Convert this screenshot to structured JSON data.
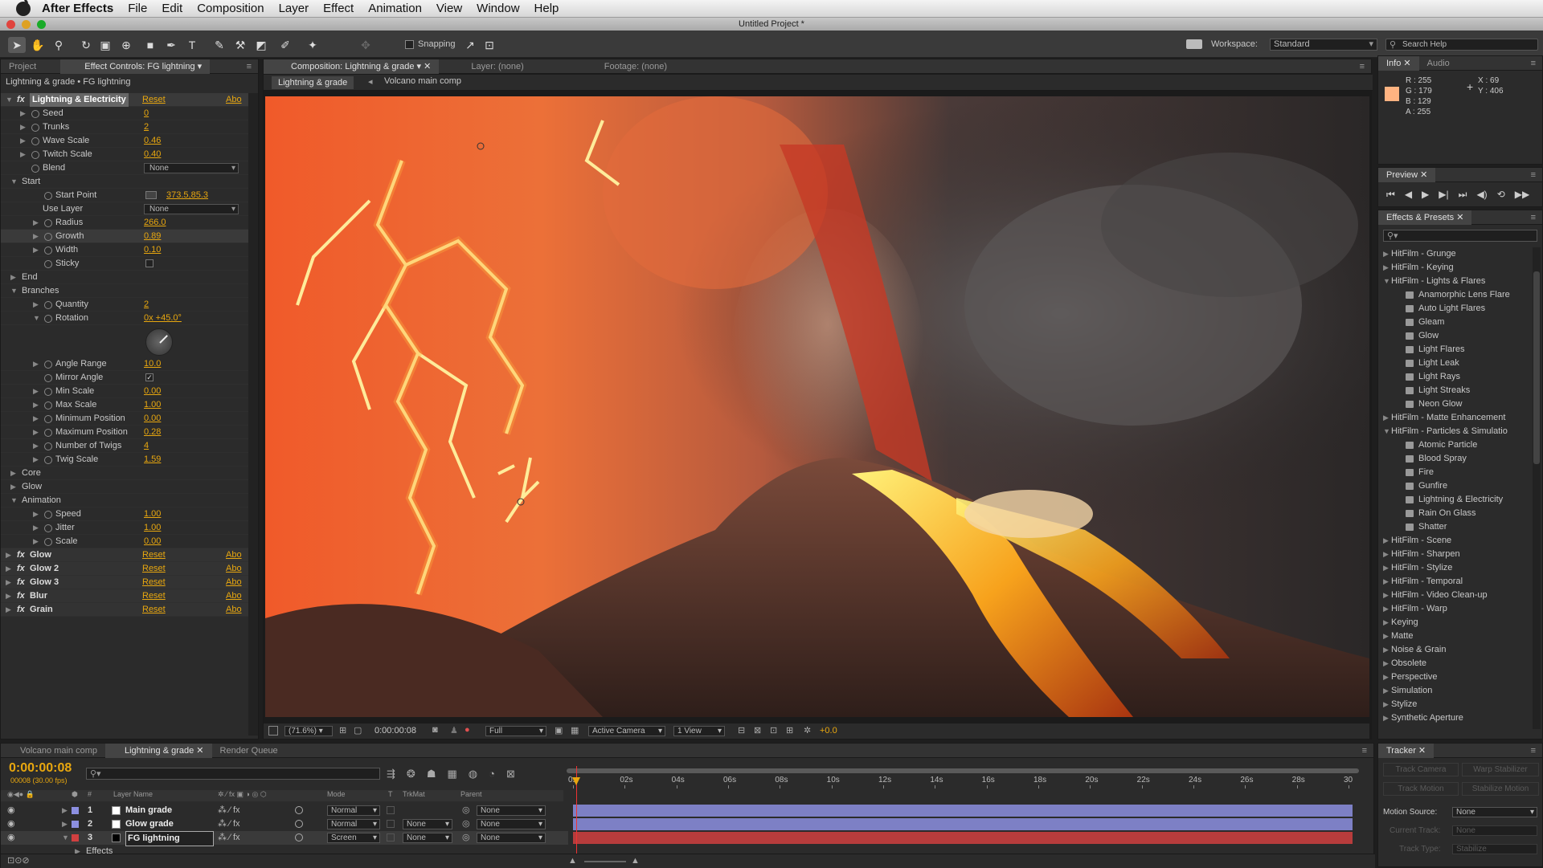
{
  "menubar": {
    "app": "After Effects",
    "items": [
      "File",
      "Edit",
      "Composition",
      "Layer",
      "Effect",
      "Animation",
      "View",
      "Window",
      "Help"
    ]
  },
  "window": {
    "title": "Untitled Project *"
  },
  "toolbar": {
    "snapping": "Snapping",
    "workspace_label": "Workspace:",
    "workspace_value": "Standard",
    "search_placeholder": "Search Help"
  },
  "left_panel": {
    "tab_project": "Project",
    "tab_effect": "Effect Controls: FG lightning",
    "breadcrumb": "Lightning & grade • FG lightning",
    "main_effect": {
      "name": "Lightning & Electricity",
      "reset": "Reset",
      "about": "Abo"
    },
    "props": [
      {
        "label": "Seed",
        "value": "0",
        "indent": 1,
        "tri": "right"
      },
      {
        "label": "Trunks",
        "value": "2",
        "indent": 1,
        "tri": "right"
      },
      {
        "label": "Wave Scale",
        "value": "0.46",
        "indent": 1,
        "tri": "right"
      },
      {
        "label": "Twitch Scale",
        "value": "0.40",
        "indent": 1,
        "tri": "right"
      },
      {
        "label": "Blend",
        "dropdown": "None",
        "indent": 1,
        "tri": "none"
      },
      {
        "label": "Start",
        "indent": 0,
        "tri": "down",
        "group": true
      },
      {
        "label": "Start Point",
        "value": "373.5,85.3",
        "indent": 2,
        "tri": "none",
        "point": true
      },
      {
        "label": "Use Layer",
        "dropdown": "None",
        "indent": 2,
        "tri": "none",
        "nosw": true
      },
      {
        "label": "Radius",
        "value": "266.0",
        "indent": 2,
        "tri": "right"
      },
      {
        "label": "Growth",
        "value": "0.89",
        "indent": 2,
        "tri": "right",
        "hl": true
      },
      {
        "label": "Width",
        "value": "0.10",
        "indent": 2,
        "tri": "right"
      },
      {
        "label": "Sticky",
        "checkbox": "",
        "indent": 2,
        "tri": "none"
      },
      {
        "label": "End",
        "indent": 0,
        "tri": "right",
        "group": true
      },
      {
        "label": "Branches",
        "indent": 0,
        "tri": "down",
        "group": true
      },
      {
        "label": "Quantity",
        "value": "2",
        "indent": 2,
        "tri": "right"
      },
      {
        "label": "Rotation",
        "value": "0x +45.0°",
        "indent": 2,
        "tri": "down",
        "dial": true
      },
      {
        "label": "Angle Range",
        "value": "10.0",
        "indent": 2,
        "tri": "right"
      },
      {
        "label": "Mirror Angle",
        "checkbox": "✓",
        "indent": 2,
        "tri": "none"
      },
      {
        "label": "Min Scale",
        "value": "0.00",
        "indent": 2,
        "tri": "right"
      },
      {
        "label": "Max Scale",
        "value": "1.00",
        "indent": 2,
        "tri": "right"
      },
      {
        "label": "Minimum Position",
        "value": "0.00",
        "indent": 2,
        "tri": "right"
      },
      {
        "label": "Maximum Position",
        "value": "0.28",
        "indent": 2,
        "tri": "right"
      },
      {
        "label": "Number of Twigs",
        "value": "4",
        "indent": 2,
        "tri": "right"
      },
      {
        "label": "Twig Scale",
        "value": "1.59",
        "indent": 2,
        "tri": "right"
      },
      {
        "label": "Core",
        "indent": 0,
        "tri": "right",
        "group": true
      },
      {
        "label": "Glow",
        "indent": 0,
        "tri": "right",
        "group": true
      },
      {
        "label": "Animation",
        "indent": 0,
        "tri": "down",
        "group": true
      },
      {
        "label": "Speed",
        "value": "1.00",
        "indent": 2,
        "tri": "right"
      },
      {
        "label": "Jitter",
        "value": "1.00",
        "indent": 2,
        "tri": "right"
      },
      {
        "label": "Scale",
        "value": "0.00",
        "indent": 2,
        "tri": "right"
      }
    ],
    "effects": [
      {
        "name": "Glow",
        "reset": "Reset",
        "about": "Abo"
      },
      {
        "name": "Glow 2",
        "reset": "Reset",
        "about": "Abo"
      },
      {
        "name": "Glow 3",
        "reset": "Reset",
        "about": "Abo"
      },
      {
        "name": "Blur",
        "reset": "Reset",
        "about": "Abo"
      },
      {
        "name": "Grain",
        "reset": "Reset",
        "about": "Abo"
      }
    ]
  },
  "comp": {
    "tab_comp": "Composition: Lightning & grade",
    "tab_layer": "Layer: (none)",
    "tab_footage": "Footage: (none)",
    "crumb_active": "Lightning & grade",
    "crumb_next": "Volcano main comp",
    "footer": {
      "zoom": "(71.6%)",
      "timecode": "0:00:00:08",
      "resolution": "Full",
      "camera": "Active Camera",
      "view": "1 View",
      "exposure": "+0.0"
    }
  },
  "info": {
    "tab": "Info",
    "tab2": "Audio",
    "r": "R : 255",
    "g": "G : 179",
    "b": "B : 129",
    "a": "A : 255",
    "x": "X : 69",
    "y": "Y : 406",
    "swatch": "#ffb381"
  },
  "preview": {
    "tab": "Preview"
  },
  "effects_presets": {
    "tab": "Effects & Presets",
    "items": [
      {
        "label": "HitFilm - Grunge",
        "lvl": 0,
        "tri": "right"
      },
      {
        "label": "HitFilm - Keying",
        "lvl": 0,
        "tri": "right"
      },
      {
        "label": "HitFilm - Lights & Flares",
        "lvl": 0,
        "tri": "down"
      },
      {
        "label": "Anamorphic Lens Flare",
        "lvl": 1
      },
      {
        "label": "Auto Light Flares",
        "lvl": 1
      },
      {
        "label": "Gleam",
        "lvl": 1
      },
      {
        "label": "Glow",
        "lvl": 1
      },
      {
        "label": "Light Flares",
        "lvl": 1
      },
      {
        "label": "Light Leak",
        "lvl": 1
      },
      {
        "label": "Light Rays",
        "lvl": 1
      },
      {
        "label": "Light Streaks",
        "lvl": 1
      },
      {
        "label": "Neon Glow",
        "lvl": 1
      },
      {
        "label": "HitFilm - Matte Enhancement",
        "lvl": 0,
        "tri": "right"
      },
      {
        "label": "HitFilm - Particles & Simulatio",
        "lvl": 0,
        "tri": "down"
      },
      {
        "label": "Atomic Particle",
        "lvl": 1
      },
      {
        "label": "Blood Spray",
        "lvl": 1
      },
      {
        "label": "Fire",
        "lvl": 1
      },
      {
        "label": "Gunfire",
        "lvl": 1
      },
      {
        "label": "Lightning & Electricity",
        "lvl": 1
      },
      {
        "label": "Rain On Glass",
        "lvl": 1
      },
      {
        "label": "Shatter",
        "lvl": 1
      },
      {
        "label": "HitFilm - Scene",
        "lvl": 0,
        "tri": "right"
      },
      {
        "label": "HitFilm - Sharpen",
        "lvl": 0,
        "tri": "right"
      },
      {
        "label": "HitFilm - Stylize",
        "lvl": 0,
        "tri": "right"
      },
      {
        "label": "HitFilm - Temporal",
        "lvl": 0,
        "tri": "right"
      },
      {
        "label": "HitFilm - Video Clean-up",
        "lvl": 0,
        "tri": "right"
      },
      {
        "label": "HitFilm - Warp",
        "lvl": 0,
        "tri": "right"
      },
      {
        "label": "Keying",
        "lvl": 0,
        "tri": "right"
      },
      {
        "label": "Matte",
        "lvl": 0,
        "tri": "right"
      },
      {
        "label": "Noise & Grain",
        "lvl": 0,
        "tri": "right"
      },
      {
        "label": "Obsolete",
        "lvl": 0,
        "tri": "right"
      },
      {
        "label": "Perspective",
        "lvl": 0,
        "tri": "right"
      },
      {
        "label": "Simulation",
        "lvl": 0,
        "tri": "right"
      },
      {
        "label": "Stylize",
        "lvl": 0,
        "tri": "right"
      },
      {
        "label": "Synthetic Aperture",
        "lvl": 0,
        "tri": "right"
      }
    ]
  },
  "timeline": {
    "tabs": [
      "Volcano main comp",
      "Lightning & grade",
      "Render Queue"
    ],
    "timecode": "0:00:00:08",
    "frame": "00008 (30.00 fps)",
    "headers": {
      "num": "#",
      "name": "Layer Name",
      "mode": "Mode",
      "t": "T",
      "trkmat": "TrkMat",
      "parent": "Parent"
    },
    "ruler": [
      "0s",
      "02s",
      "04s",
      "06s",
      "08s",
      "10s",
      "12s",
      "14s",
      "16s",
      "18s",
      "20s",
      "22s",
      "24s",
      "26s",
      "28s",
      "30"
    ],
    "layers": [
      {
        "num": "1",
        "name": "Main grade",
        "mode": "Normal",
        "trkmat": "",
        "parent": "None",
        "color": "#8c8fe0",
        "swatch": "#ffffff"
      },
      {
        "num": "2",
        "name": "Glow grade",
        "mode": "Normal",
        "trkmat": "None",
        "parent": "None",
        "color": "#8c8fe0",
        "swatch": "#ffffff"
      },
      {
        "num": "3",
        "name": "FG lightning",
        "mode": "Screen",
        "trkmat": "None",
        "parent": "None",
        "color": "#d04040",
        "swatch": "#000000"
      }
    ],
    "effects_row": "Effects"
  },
  "tracker": {
    "tab": "Tracker",
    "track_camera": "Track Camera",
    "warp": "Warp Stabilizer",
    "track_motion": "Track Motion",
    "stabilize": "Stabilize Motion",
    "motion_source_label": "Motion Source:",
    "motion_source": "None",
    "current_track_label": "Current Track:",
    "current_track": "None",
    "track_type_label": "Track Type:",
    "track_type": "Stabilize"
  }
}
